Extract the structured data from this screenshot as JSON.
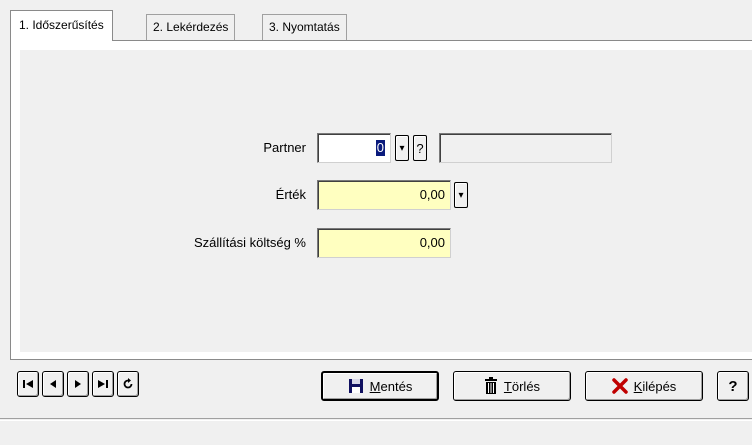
{
  "tabs": [
    {
      "label": "1. Időszerűsítés",
      "active": true
    },
    {
      "label": "2. Lekérdezés",
      "active": false
    },
    {
      "label": "3. Nyomtatás",
      "active": false
    }
  ],
  "form": {
    "partner_label": "Partner",
    "partner_value": "0",
    "partner_name": "",
    "question_label": "?",
    "ertek_label": "Érték",
    "ertek_value": "0,00",
    "szallitasi_label": "Szállítási költség %",
    "szallitasi_value": "0,00"
  },
  "buttons": {
    "save": {
      "prefix": "",
      "ul": "M",
      "rest": "entés"
    },
    "delete": {
      "ul": "T",
      "rest": "örlés"
    },
    "exit": {
      "ul": "K",
      "rest": "ilépés"
    },
    "help": "?"
  },
  "colors": {
    "field_yellow": "#ffffc0",
    "selection": "#0a1a7c",
    "exit_icon": "#c00000"
  }
}
